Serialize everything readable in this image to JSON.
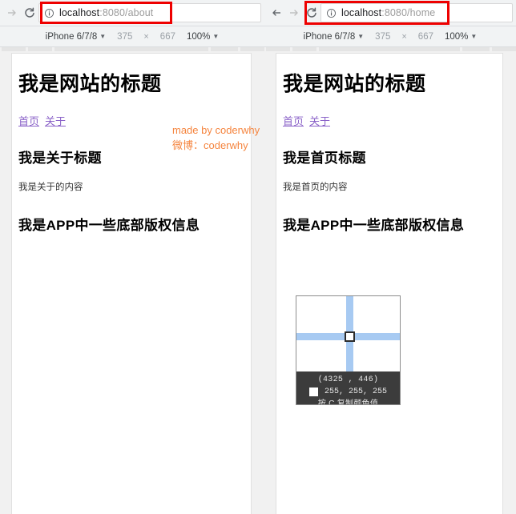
{
  "panels": [
    {
      "id": "left",
      "nav": {
        "back_enabled": false,
        "forward_enabled": false,
        "reload_label": "reload-icon"
      },
      "omnibox": {
        "info_icon": "info-circle-icon",
        "host": "localhost",
        "path": ":8080/about",
        "full_url": "localhost:8080/about"
      },
      "device_toolbar": {
        "device": "iPhone 6/7/8",
        "width": "375",
        "times": "×",
        "height": "667",
        "zoom": "100%"
      },
      "page": {
        "site_title": "我是网站的标题",
        "links": [
          "首页",
          "关于"
        ],
        "section_title": "我是关于标题",
        "section_body": "我是关于的内容",
        "footer_title": "我是APP中一些底部版权信息"
      }
    },
    {
      "id": "right",
      "nav": {
        "back_enabled": true,
        "forward_enabled": false,
        "reload_label": "reload-icon"
      },
      "omnibox": {
        "info_icon": "info-circle-icon",
        "host": "localhost",
        "path": ":8080/home",
        "full_url": "localhost:8080/home"
      },
      "device_toolbar": {
        "device": "iPhone 6/7/8",
        "width": "375",
        "times": "×",
        "height": "667",
        "zoom": "100%"
      },
      "page": {
        "site_title": "我是网站的标题",
        "links": [
          "首页",
          "关于"
        ],
        "section_title": "我是首页标题",
        "section_body": "我是首页的内容",
        "footer_title": "我是APP中一些底部版权信息"
      }
    }
  ],
  "watermark": {
    "line1": "made by coderwhy",
    "line2": "微博：coderwhy",
    "color": "#f5853f"
  },
  "color_picker": {
    "coordinates": "(4325   ,   446)",
    "rgb": "255, 255, 255",
    "swatch_color": "#ffffff",
    "hint": "按 C 复制颜色值",
    "crosshair_color": "#a7caf2"
  },
  "annotations": {
    "highlight_color": "#ee0000"
  }
}
